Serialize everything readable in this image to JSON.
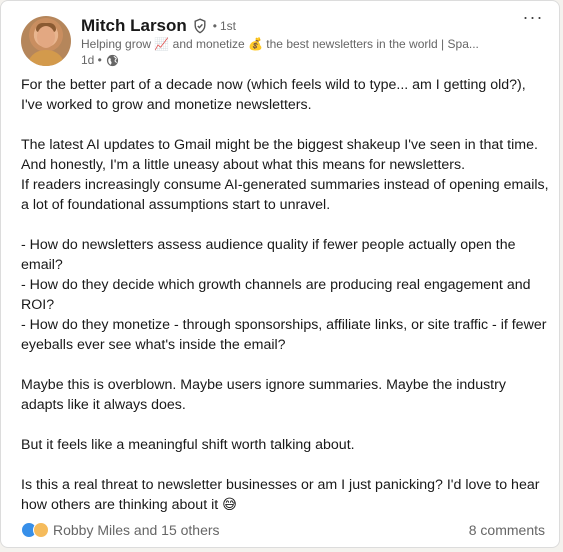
{
  "post": {
    "author": {
      "name": "Mitch Larson",
      "degree": "1st",
      "separator": "•",
      "headline": "Helping grow 📈 and monetize 💰 the best newsletters in the world | Spa...",
      "time": "1d •"
    },
    "menu_label": "···",
    "paragraphs": [
      "For the better part of a decade now (which feels wild to type... am I getting old?), I've worked to grow and monetize newsletters.",
      "The latest AI updates to Gmail might be the biggest shakeup I've seen in that time. And honestly, I'm a little uneasy about what this means for newsletters.\nIf readers increasingly consume AI-generated summaries instead of opening emails, a lot of foundational assumptions start to unravel.",
      "- How do newsletters assess audience quality if fewer people actually open the email?\n - How do they decide which growth channels are producing real engagement and ROI?\n - How do they monetize - through sponsorships, affiliate links, or site traffic - if fewer eyeballs ever see what's inside the email?",
      "Maybe this is overblown. Maybe users ignore summaries. Maybe the industry adapts like it always does.",
      "But it feels like a meaningful shift worth talking about.",
      "Is this a real threat to newsletter businesses or am I just panicking? I'd love to hear how others are thinking about it 😅"
    ],
    "social": {
      "reactors": "Robby Miles and 15 others",
      "comments": "8 comments",
      "reaction_icons": [
        "like-icon",
        "insightful-icon"
      ]
    }
  },
  "colors": {
    "like": "#378fe9",
    "insightful": "#f5bb5c",
    "muted_text": "#666666"
  }
}
